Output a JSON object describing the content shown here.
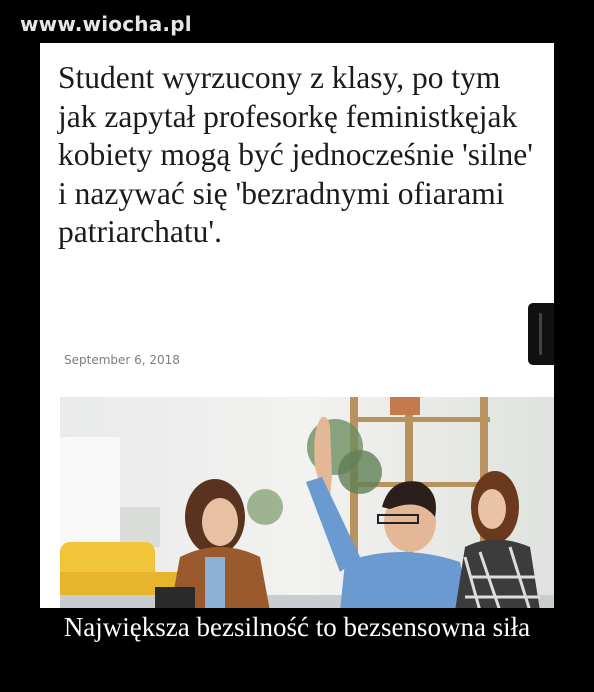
{
  "watermark": "www.wiocha.pl",
  "article": {
    "headline": "Student wyrzucony z klasy, po tym jak zapytał profesorkę feministkęjak kobiety mogą być jednocześnie 'silne' i nazywać się 'bezradnymi ofiarami patriarchatu'.",
    "date": "September 6, 2018"
  },
  "caption": "Największa bezsilność to bezsensowna siła",
  "colors": {
    "background": "#000000",
    "card": "#ffffff",
    "headline_text": "#1b1b1b",
    "date_text": "#7d7d7d",
    "caption_text": "#ffffff"
  }
}
